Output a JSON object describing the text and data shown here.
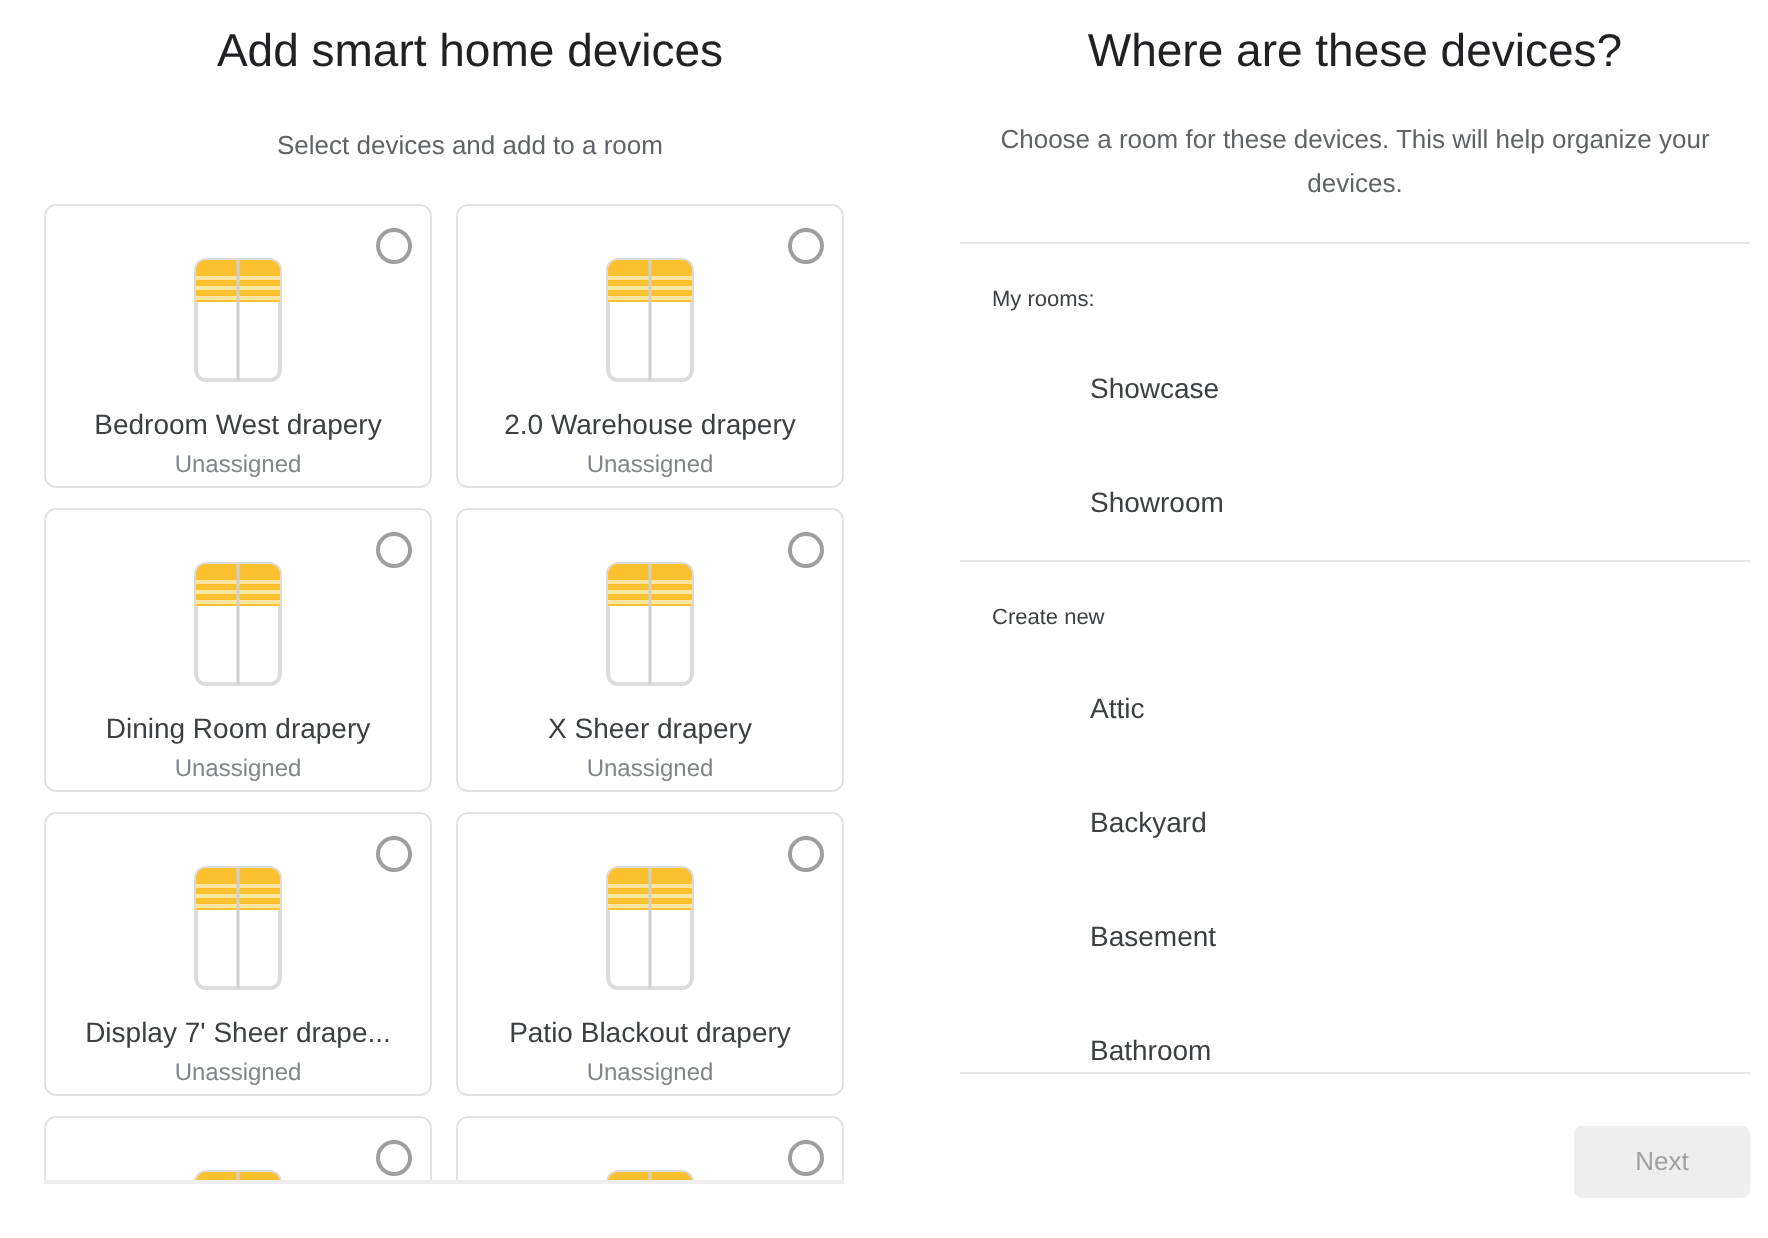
{
  "devices_panel": {
    "title": "Add smart home devices",
    "subtitle": "Select devices and add to a room",
    "cards": [
      {
        "name": "Bedroom West drapery",
        "status": "Unassigned",
        "selected": false
      },
      {
        "name": "2.0 Warehouse drapery",
        "status": "Unassigned",
        "selected": false
      },
      {
        "name": "Dining Room drapery",
        "status": "Unassigned",
        "selected": false
      },
      {
        "name": "X Sheer drapery",
        "status": "Unassigned",
        "selected": false
      },
      {
        "name": "Display 7' Sheer drape...",
        "status": "Unassigned",
        "selected": false
      },
      {
        "name": "Patio Blackout drapery",
        "status": "Unassigned",
        "selected": false
      },
      {
        "selected": false
      },
      {
        "selected": false
      }
    ]
  },
  "rooms_panel": {
    "title": "Where are these devices?",
    "subtitle": "Choose a room for these devices. This will help organize your devices.",
    "sections": [
      {
        "label": "My rooms:",
        "items": [
          "Showcase",
          "Showroom"
        ]
      },
      {
        "label": "Create new",
        "items": [
          "Attic",
          "Backyard",
          "Basement",
          "Bathroom"
        ]
      }
    ],
    "next_button": {
      "label": "Next",
      "disabled": true
    }
  }
}
